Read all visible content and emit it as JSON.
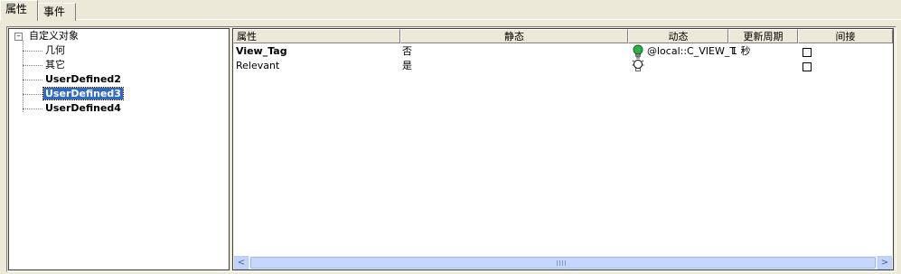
{
  "tabs": [
    {
      "label": "属性",
      "active": true
    },
    {
      "label": "事件",
      "active": false
    }
  ],
  "tree": {
    "root": {
      "label": "自定义对象",
      "expanded": true,
      "expander": "⊟"
    },
    "children": [
      {
        "label": "几何",
        "bold": false,
        "selected": false
      },
      {
        "label": "其它",
        "bold": false,
        "selected": false
      },
      {
        "label": "UserDefined2",
        "bold": true,
        "selected": false
      },
      {
        "label": "UserDefined3",
        "bold": true,
        "selected": true
      },
      {
        "label": "UserDefined4",
        "bold": true,
        "selected": false
      }
    ]
  },
  "grid": {
    "columns": [
      "属性",
      "静态",
      "动态",
      "更新周期",
      "间接"
    ],
    "rows": [
      {
        "property": "View_Tag",
        "bold": true,
        "static": "否",
        "dynamic_icon": "lightbulb-green-icon",
        "dynamic": "@local::C_VIEW_T",
        "update": "1 秒",
        "indirect": false
      },
      {
        "property": "Relevant",
        "bold": false,
        "static": "是",
        "dynamic_icon": "lightbulb-white-icon",
        "dynamic": "",
        "update": "",
        "indirect": false
      }
    ]
  },
  "scrollbar": {
    "left_arrow": "<",
    "right_arrow": ">"
  },
  "colors": {
    "selection": "#316AC5",
    "bulb_active": "#2BB04A",
    "background": "#ECE9D8"
  }
}
